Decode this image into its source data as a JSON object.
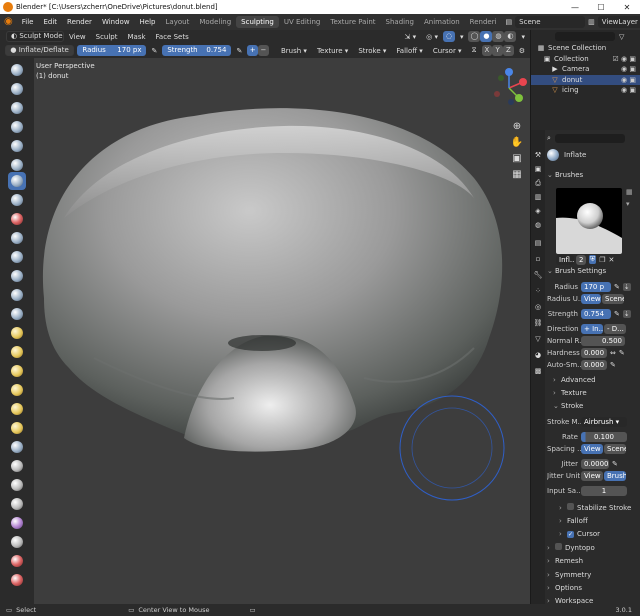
{
  "window": {
    "title": "Blender* [C:\\Users\\zcherr\\OneDrive\\Pictures\\donut.blend]",
    "minimize": "—",
    "maximize": "☐",
    "close": "✕"
  },
  "menu": [
    "File",
    "Edit",
    "Render",
    "Window",
    "Help"
  ],
  "workspaces": [
    {
      "label": "Layout",
      "active": false
    },
    {
      "label": "Modeling",
      "active": false
    },
    {
      "label": "Sculpting",
      "active": true
    },
    {
      "label": "UV Editing",
      "active": false
    },
    {
      "label": "Texture Paint",
      "active": false
    },
    {
      "label": "Shading",
      "active": false
    },
    {
      "label": "Animation",
      "active": false
    },
    {
      "label": "Renderi",
      "active": false
    }
  ],
  "scene": {
    "label": "Scene",
    "view_layer": "ViewLayer"
  },
  "header": {
    "mode": "Sculpt Mode",
    "menus": [
      "View",
      "Sculpt",
      "Mask",
      "Face Sets"
    ],
    "brush_name": "Inflate/Deflate",
    "radius_label": "Radius",
    "radius_value": "170 px",
    "strength_label": "Strength",
    "strength_value": "0.754",
    "plus": "+",
    "minus": "−",
    "dropdowns": [
      "Brush",
      "Texture",
      "Stroke",
      "Falloff",
      "Cursor"
    ],
    "axes": [
      "X",
      "Y",
      "Z"
    ]
  },
  "viewport": {
    "perspective": "User Perspective",
    "object": "(1) donut",
    "gizmo": {
      "x_color": "#e8454f",
      "y_color": "#7fc23c",
      "z_color": "#4a86e8"
    },
    "brush_circle_color": "#2f5fc8"
  },
  "outliner": {
    "rows": [
      {
        "label": "Scene Collection",
        "icon": "▦",
        "indent": 0,
        "selected": false
      },
      {
        "label": "Collection",
        "icon": "▣",
        "indent": 1,
        "selected": false
      },
      {
        "label": "Camera",
        "icon": "▶",
        "indent": 2,
        "selected": false
      },
      {
        "label": "donut",
        "icon": "▽",
        "indent": 2,
        "selected": true
      },
      {
        "label": "icing",
        "icon": "▽",
        "indent": 2,
        "selected": false
      }
    ]
  },
  "properties": {
    "brush_title": "Inflate",
    "brushes_header": "Brushes",
    "brush_slot_name": "Infl...",
    "brush_slot_users": "2",
    "brush_settings_header": "Brush Settings",
    "radius": {
      "label": "Radius",
      "value": "170 p"
    },
    "radius_unit": {
      "label": "Radius U...",
      "opt1": "View",
      "opt2": "Scene"
    },
    "strength": {
      "label": "Strength",
      "value": "0.754"
    },
    "direction": {
      "label": "Direction",
      "opt1": "+ In...",
      "opt2": "- D..."
    },
    "normal_radius": {
      "label": "Normal R...",
      "value": "0.500"
    },
    "hardness": {
      "label": "Hardness",
      "value": "0.000"
    },
    "auto_smooth": {
      "label": "Auto-Sm...",
      "value": "0.000"
    },
    "advanced": "Advanced",
    "texture": "Texture",
    "stroke": "Stroke",
    "stroke_method": {
      "label": "Stroke M...",
      "value": "Airbrush"
    },
    "rate": {
      "label": "Rate",
      "value": "0.100"
    },
    "spacing": {
      "label": "Spacing ...",
      "opt1": "View",
      "opt2": "Scene"
    },
    "jitter": {
      "label": "Jitter",
      "value": "0.0000"
    },
    "jitter_unit": {
      "label": "Jitter Unit",
      "opt1": "View",
      "opt2": "Brush"
    },
    "input_samples": {
      "label": "Input Sa...",
      "value": "1"
    },
    "stabilize": "Stabilize Stroke",
    "falloff": "Falloff",
    "cursor": "Cursor",
    "dyntopo": "Dyntopo",
    "remesh": "Remesh",
    "symmetry": "Symmetry",
    "options": "Options",
    "workspace": "Workspace"
  },
  "status": {
    "left": "Select",
    "middle": "Center View to Mouse",
    "version": "3.0.1"
  },
  "colors": {
    "accent_blue": "#4772b3",
    "background": "#3d3d3d",
    "selection": "#334d80"
  }
}
